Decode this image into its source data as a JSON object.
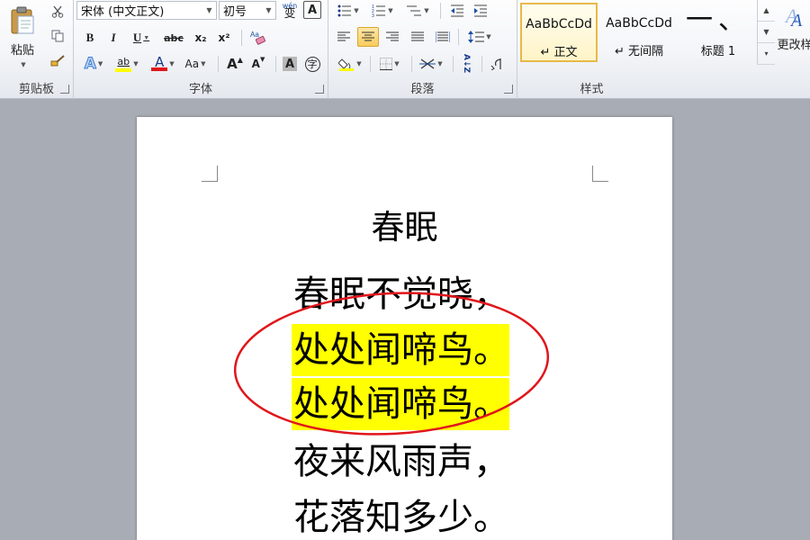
{
  "ribbon": {
    "clipboard": {
      "label": "剪贴板",
      "paste_label": "粘贴"
    },
    "font": {
      "label": "字体",
      "font_name": "宋体 (中文正文)",
      "font_size": "初号",
      "phonetic_glyph": "wén",
      "phonetic_char": "变",
      "border_char": "A",
      "bold": "B",
      "italic": "I",
      "underline": "U",
      "strike": "abc",
      "subscript": "x₂",
      "superscript": "x²",
      "change_case": "Aa",
      "grow": "A",
      "shrink": "A",
      "shading": "A",
      "enclose": "字",
      "highlight": "ab",
      "font_color": "A",
      "text_effects": "A"
    },
    "paragraph": {
      "label": "段落",
      "sort": "A↓Z"
    },
    "styles": {
      "label": "样式",
      "tiles": [
        {
          "sample": "AaBbCcDd",
          "name": "↵ 正文"
        },
        {
          "sample": "AaBbCcDd",
          "name": "↵ 无间隔"
        },
        {
          "sample": "一、",
          "name": "标题 1"
        }
      ],
      "change_styles_label": "更改样"
    }
  },
  "document": {
    "title": "春眠",
    "lines": [
      "春眠不觉晓，",
      "处处闻啼鸟。",
      "处处闻啼鸟。",
      "夜来风雨声，",
      "花落知多少。"
    ],
    "highlight_color": "#ffff00",
    "annotation_color": "#e0161b"
  }
}
